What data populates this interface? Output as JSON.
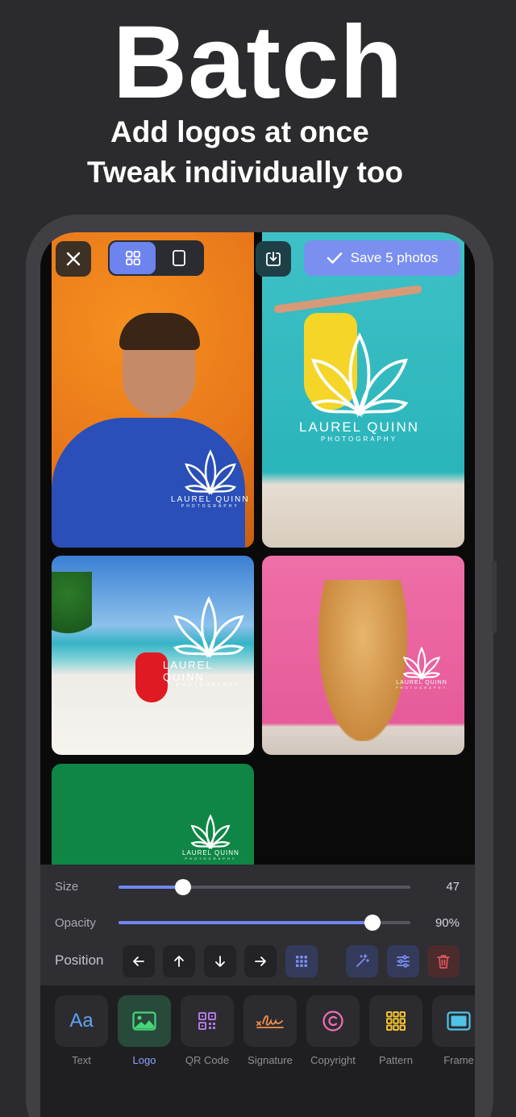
{
  "hero": {
    "title": "Batch",
    "subtitle_line1": "Add logos at once",
    "subtitle_line2": "Tweak individually too"
  },
  "toolbar": {
    "close_icon": "close-icon",
    "view_modes": [
      "grid-icon",
      "single-icon"
    ],
    "active_view": "grid",
    "download_icon": "download-icon",
    "save_label": "Save 5 photos"
  },
  "watermark": {
    "name": "LAUREL QUINN",
    "tagline": "PHOTOGRAPHY"
  },
  "controls": {
    "size": {
      "label": "Size",
      "value": "47",
      "fraction": 0.22
    },
    "opacity": {
      "label": "Opacity",
      "value": "90%",
      "fraction": 0.87
    },
    "position": {
      "label": "Position",
      "buttons": [
        "arrow-left-icon",
        "arrow-up-icon",
        "arrow-down-icon",
        "arrow-right-icon",
        "grid-position-icon"
      ],
      "actions": [
        "magic-wand-icon",
        "sliders-icon",
        "trash-icon"
      ]
    }
  },
  "tools": [
    {
      "label": "Text",
      "icon": "text-icon",
      "glyph": "Aa"
    },
    {
      "label": "Logo",
      "icon": "image-icon",
      "active": true
    },
    {
      "label": "QR Code",
      "icon": "qr-icon"
    },
    {
      "label": "Signature",
      "icon": "signature-icon"
    },
    {
      "label": "Copyright",
      "icon": "copyright-icon",
      "glyph": "©"
    },
    {
      "label": "Pattern",
      "icon": "pattern-icon"
    },
    {
      "label": "Frame",
      "icon": "frame-icon"
    }
  ],
  "colors": {
    "accent": "#7b8ff0",
    "background": "#2b2a2c"
  }
}
